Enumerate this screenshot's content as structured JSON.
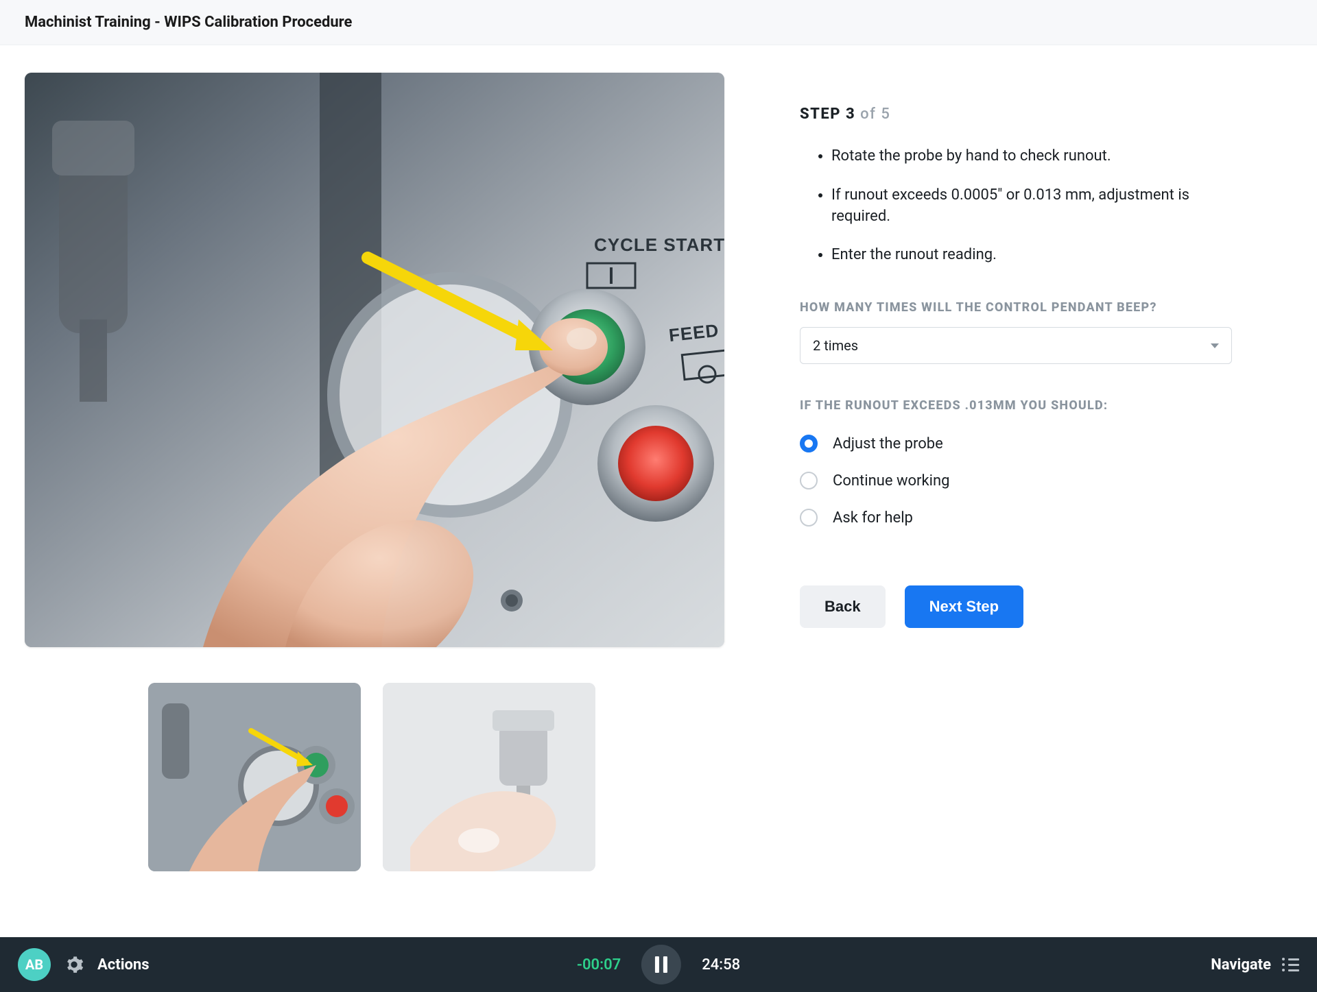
{
  "header": {
    "title": "Machinist Training - WIPS Calibration Procedure"
  },
  "step": {
    "label": "STEP 3",
    "of": " of 5",
    "instructions": [
      "Rotate the probe by hand to check runout.",
      "If runout exceeds 0.0005\" or 0.013 mm, adjustment is required.",
      "Enter the runout reading."
    ]
  },
  "q1": {
    "label": "HOW MANY TIMES WILL THE CONTROL PENDANT BEEP?",
    "selected": "2 times"
  },
  "q2": {
    "label": "IF THE RUNOUT EXCEEDS .013MM YOU SHOULD:",
    "options": [
      {
        "label": "Adjust the probe",
        "selected": true
      },
      {
        "label": "Continue working",
        "selected": false
      },
      {
        "label": "Ask for help",
        "selected": false
      }
    ]
  },
  "buttons": {
    "back": "Back",
    "next": "Next Step"
  },
  "image": {
    "panel_labels": {
      "cycle_start": "CYCLE START",
      "feed_hold": "FEED HOLD"
    }
  },
  "footer": {
    "avatar": "AB",
    "actions": "Actions",
    "time_neg": "-00:07",
    "time_pos": "24:58",
    "navigate": "Navigate"
  }
}
